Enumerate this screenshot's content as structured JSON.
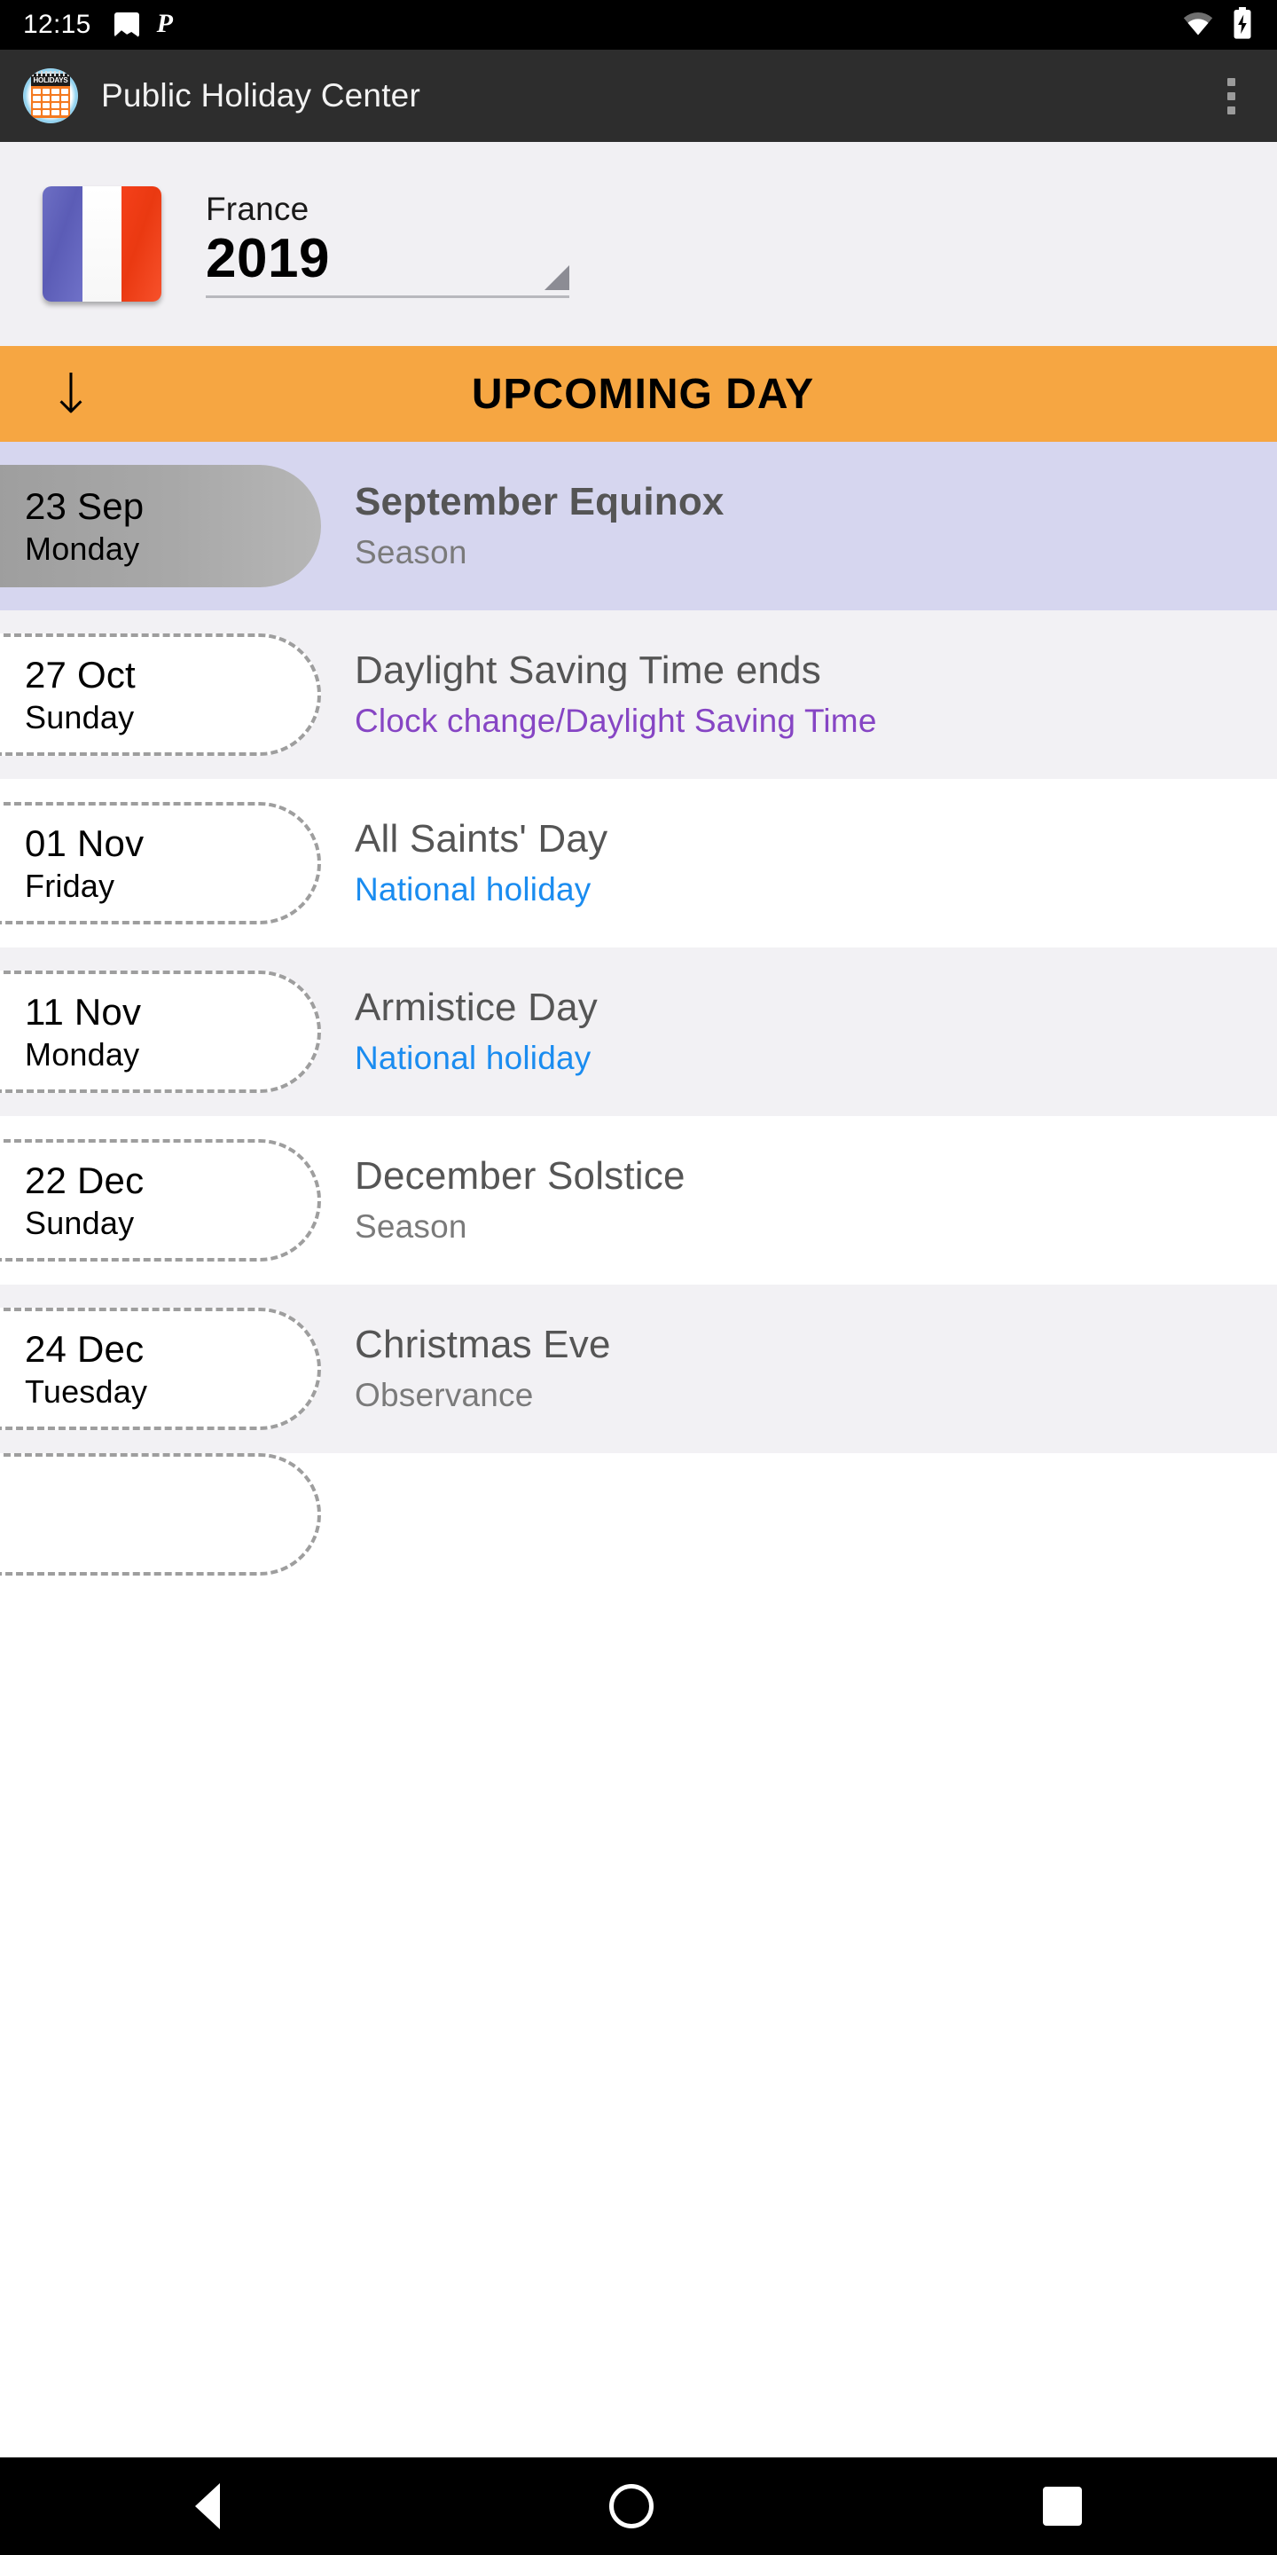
{
  "status_bar": {
    "time": "12:15",
    "left_icons": [
      "photo-icon",
      "p-app-icon"
    ],
    "right_icons": [
      "wifi-icon",
      "battery-charging-icon"
    ]
  },
  "app_bar": {
    "logo_icon": "holidays-calendar-icon",
    "logo_label": "HOLIDAYS",
    "title": "Public Holiday Center",
    "overflow_icon": "three-dot-menu-icon"
  },
  "selector": {
    "flag_icon": "france-flag-icon",
    "country": "France",
    "year": "2019",
    "caret_icon": "spinner-caret-icon"
  },
  "banner": {
    "arrow_icon": "down-arrow-icon",
    "arrow_glyph": "↓",
    "title": "UPCOMING DAY"
  },
  "colors": {
    "banner_bg": "#F6A642",
    "highlight_row_bg": "#D6D6EF",
    "alt_row_bg": "#F2F1F4",
    "plain_row_bg": "#FFFFFF",
    "national_holiday": "#1A8CF0",
    "clock_change": "#8645C4",
    "season": "#7A7A7A",
    "observance": "#7A7A7A",
    "app_bar_bg": "#2D2D2D",
    "selector_bg": "#F1F0F3"
  },
  "holidays": [
    {
      "date": "23 Sep",
      "weekday": "Monday",
      "name": "September Equinox",
      "type": "Season",
      "type_class": "type-season",
      "highlight": true
    },
    {
      "date": "27 Oct",
      "weekday": "Sunday",
      "name": "Daylight Saving Time ends",
      "type": "Clock change/Daylight Saving Time",
      "type_class": "type-clock",
      "highlight": false
    },
    {
      "date": "01 Nov",
      "weekday": "Friday",
      "name": "All Saints' Day",
      "type": "National holiday",
      "type_class": "type-national",
      "highlight": false
    },
    {
      "date": "11 Nov",
      "weekday": "Monday",
      "name": "Armistice Day",
      "type": "National holiday",
      "type_class": "type-national",
      "highlight": false
    },
    {
      "date": "22 Dec",
      "weekday": "Sunday",
      "name": "December Solstice",
      "type": "Season",
      "type_class": "type-season",
      "highlight": false
    },
    {
      "date": "24 Dec",
      "weekday": "Tuesday",
      "name": "Christmas Eve",
      "type": "Observance",
      "type_class": "type-observance",
      "highlight": false
    }
  ],
  "nav_bar": {
    "back_icon": "back-triangle-icon",
    "home_icon": "home-circle-icon",
    "recent_icon": "recents-square-icon"
  }
}
